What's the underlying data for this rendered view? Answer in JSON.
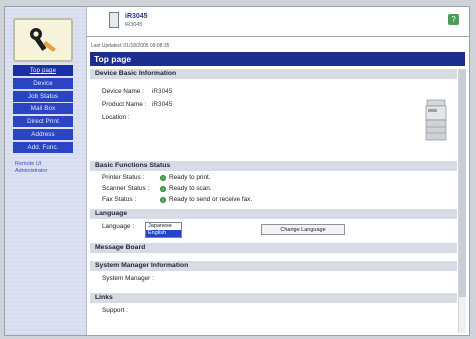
{
  "header": {
    "device_name": "iR3045",
    "device_sub": "iR3045",
    "help_label": "?"
  },
  "last_updated": "Last Updated: 01/18/2005 09:08:35",
  "page_title": "Top page",
  "sidebar": {
    "items": [
      {
        "label": "Top page",
        "active": true
      },
      {
        "label": "Device",
        "active": false
      },
      {
        "label": "Job Status",
        "active": false
      },
      {
        "label": "Mail Box",
        "active": false
      },
      {
        "label": "Direct Print",
        "active": false
      },
      {
        "label": "Address",
        "active": false
      },
      {
        "label": "Add. Func.",
        "active": false
      }
    ],
    "extra_links": [
      "Remote UI",
      "Administrator"
    ]
  },
  "sections": {
    "basic_info": {
      "title": "Device Basic Information",
      "device_name_label": "Device Name :",
      "device_name_value": "iR3045",
      "product_name_label": "Product Name :",
      "product_name_value": "iR3045",
      "location_label": "Location :",
      "location_value": ""
    },
    "functions": {
      "title": "Basic Functions Status",
      "printer_label": "Printer Status :",
      "printer_status": "Ready to print.",
      "scanner_label": "Scanner Status :",
      "scanner_status": "Ready to scan.",
      "fax_label": "Fax Status :",
      "fax_status": "Ready to send or receive fax."
    },
    "language": {
      "title": "Language",
      "label": "Language :",
      "options": [
        "Japanese",
        "English"
      ],
      "selected": "English",
      "button_label": "Change Language"
    },
    "message_board": {
      "title": "Message Board"
    },
    "system_manager": {
      "title": "System Manager Information",
      "label": "System Manager :"
    },
    "links": {
      "title": "Links",
      "support_label": "Support :"
    }
  },
  "colors": {
    "nav_bg": "#2a44c4",
    "title_bar": "#1d2f8e",
    "status_ok": "#58b05e"
  }
}
